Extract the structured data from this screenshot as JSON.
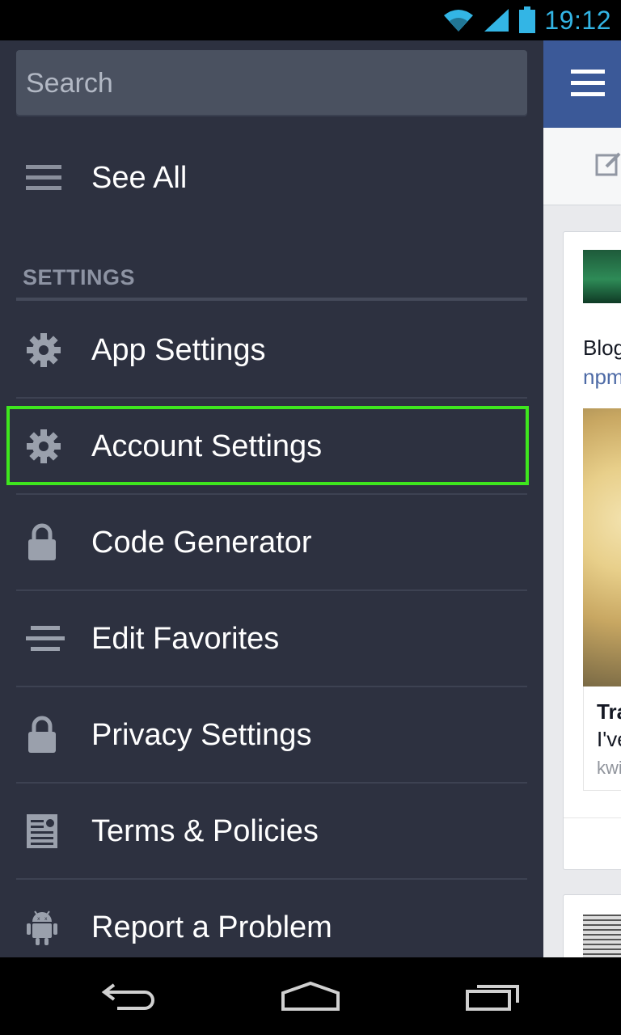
{
  "status_bar": {
    "time": "19:12",
    "icons": [
      "wifi-icon",
      "signal-icon",
      "battery-icon"
    ]
  },
  "drawer": {
    "search": {
      "placeholder": "Search",
      "value": ""
    },
    "see_all": {
      "label": "See All",
      "icon": "list-icon"
    },
    "section_header": "SETTINGS",
    "items": [
      {
        "label": "App Settings",
        "icon": "gear-icon"
      },
      {
        "label": "Account Settings",
        "icon": "gear-icon",
        "highlighted": true
      },
      {
        "label": "Code Generator",
        "icon": "lock-icon"
      },
      {
        "label": "Edit Favorites",
        "icon": "align-center-icon"
      },
      {
        "label": "Privacy Settings",
        "icon": "lock-icon"
      },
      {
        "label": "Terms & Policies",
        "icon": "document-icon"
      },
      {
        "label": "Report a Problem",
        "icon": "android-icon"
      }
    ]
  },
  "feed": {
    "post_text": "Blog",
    "post_link": "npm",
    "link_title": "Tra",
    "link_desc": "I've",
    "link_domain": "kwi"
  },
  "colors": {
    "drawer_bg": "#2d3140",
    "highlight": "#3ee61e",
    "facebook_blue": "#3b5998",
    "clock": "#33b5e5"
  },
  "nav_bar": {
    "buttons": [
      "back-icon",
      "home-icon",
      "recents-icon"
    ]
  }
}
